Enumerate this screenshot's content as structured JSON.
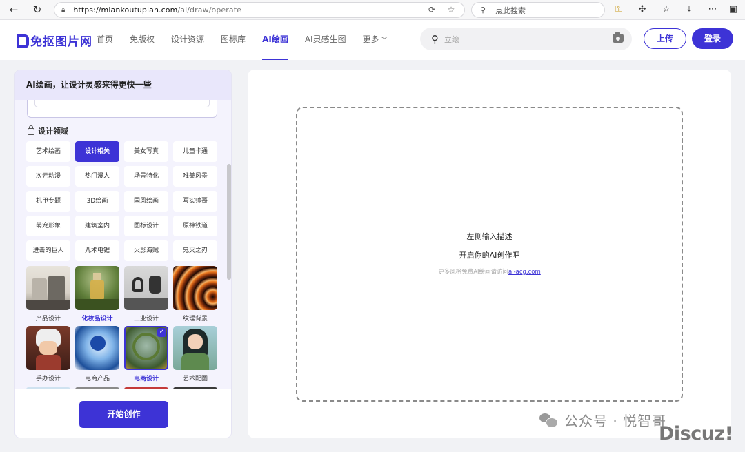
{
  "browser": {
    "url_host": "https://miankoutupian.com",
    "url_path": "/ai/draw/operate",
    "search_placeholder": "点此搜索"
  },
  "site": {
    "logo": "免抠图片网",
    "nav": [
      "首页",
      "免版权",
      "设计资源",
      "图标库",
      "AI绘画",
      "AI灵感生图",
      "更多"
    ],
    "active_nav": "AI绘画",
    "search_placeholder": "立绘",
    "upload_label": "上传",
    "login_label": "登录"
  },
  "left_panel": {
    "title": "AI绘画，让设计灵感来得更快一些",
    "section_label": "设计领域",
    "tags": [
      "艺术绘画",
      "设计相关",
      "美女写真",
      "儿童卡通",
      "次元动漫",
      "热门漫人",
      "场景特化",
      "唯美风景",
      "机甲专题",
      "3D绘画",
      "国风绘画",
      "写实帅哥",
      "萌宠形象",
      "建筑室内",
      "图标设计",
      "原神铁道",
      "进击的巨人",
      "咒术电锯",
      "火影海贼",
      "鬼灭之刃"
    ],
    "active_tag": "设计相关",
    "thumbs": [
      "产品设计",
      "化妆品设计",
      "工业设计",
      "纹理背景",
      "手办设计",
      "电商产品",
      "电商设计",
      "艺术配图"
    ],
    "create_label": "开始创作"
  },
  "right_panel": {
    "line1": "左侧输入描述",
    "line2": "开启你的AI创作吧",
    "hint_prefix": "更多风格免费AI绘画请访问",
    "hint_link": "ai-acg.com"
  },
  "watermark": {
    "wechat": "公众号 · 悦智哥",
    "discuz": "Discuz!"
  },
  "colors": {
    "accent": "#3d33d6"
  }
}
